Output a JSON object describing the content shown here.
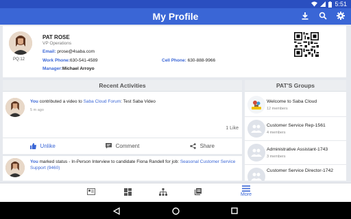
{
  "status": {
    "time": "5:51"
  },
  "appbar": {
    "title": "My Profile",
    "download_icon": "download-icon",
    "search_icon": "search-icon",
    "settings_icon": "gear-icon"
  },
  "profile": {
    "name": "PAT ROSE",
    "title": "VP Operations",
    "badge": "PQ:12",
    "email_label": "Email:",
    "email": "prose@4saba.com",
    "work_phone_label": "Work Phone:",
    "work_phone": "630-541-4589",
    "cell_phone_label": "Cell Phone:",
    "cell_phone": "630-888-9966",
    "manager_label": "Manager:",
    "manager": "Michael Arroyo"
  },
  "activities": {
    "header": "Recent Activities",
    "items": [
      {
        "actor": "You",
        "text": "contributed a video to",
        "target": "Saba Cloud Forum",
        "object": ": Test Saba Video",
        "time": "5 m ago",
        "like_count": "1 Like"
      },
      {
        "actor": "You",
        "text": "marked status - In-Person Interview to candidate Fiona Randell for job:",
        "target": "Seasonal Customer Service Support (9460)"
      }
    ],
    "actions": {
      "like": "Unlike",
      "comment": "Comment",
      "share": "Share"
    }
  },
  "groups": {
    "header": "PAT'S Groups",
    "items": [
      {
        "name": "Welcome to Saba Cloud",
        "members": "12 members"
      },
      {
        "name": "Customer Service Rep-1561",
        "members": "4 members"
      },
      {
        "name": "Administrative Assistant-1743",
        "members": "3 members"
      },
      {
        "name": "Customer Service Director-1742",
        "members": ""
      }
    ]
  },
  "bottomnav": {
    "more": "More"
  },
  "colors": {
    "primary": "#3a66d6",
    "statusbar": "#2a4fc0"
  }
}
